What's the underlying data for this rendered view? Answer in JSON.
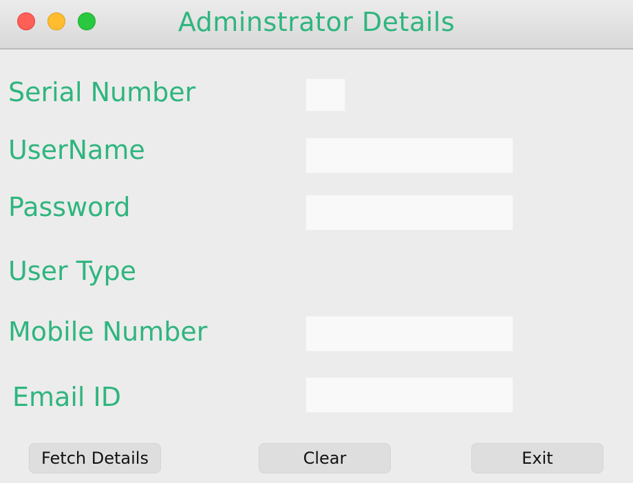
{
  "window": {
    "title": "Adminstrator Details",
    "accent_color": "#2fb57e"
  },
  "form": {
    "serial_number": {
      "label": "Serial Number",
      "value": ""
    },
    "username": {
      "label": "UserName",
      "value": ""
    },
    "password": {
      "label": "Password",
      "value": ""
    },
    "user_type": {
      "label": "User Type"
    },
    "mobile_number": {
      "label": "Mobile Number",
      "value": ""
    },
    "email_id": {
      "label": "Email ID",
      "value": ""
    }
  },
  "buttons": {
    "fetch_label": "Fetch Details",
    "clear_label": "Clear",
    "exit_label": "Exit"
  }
}
